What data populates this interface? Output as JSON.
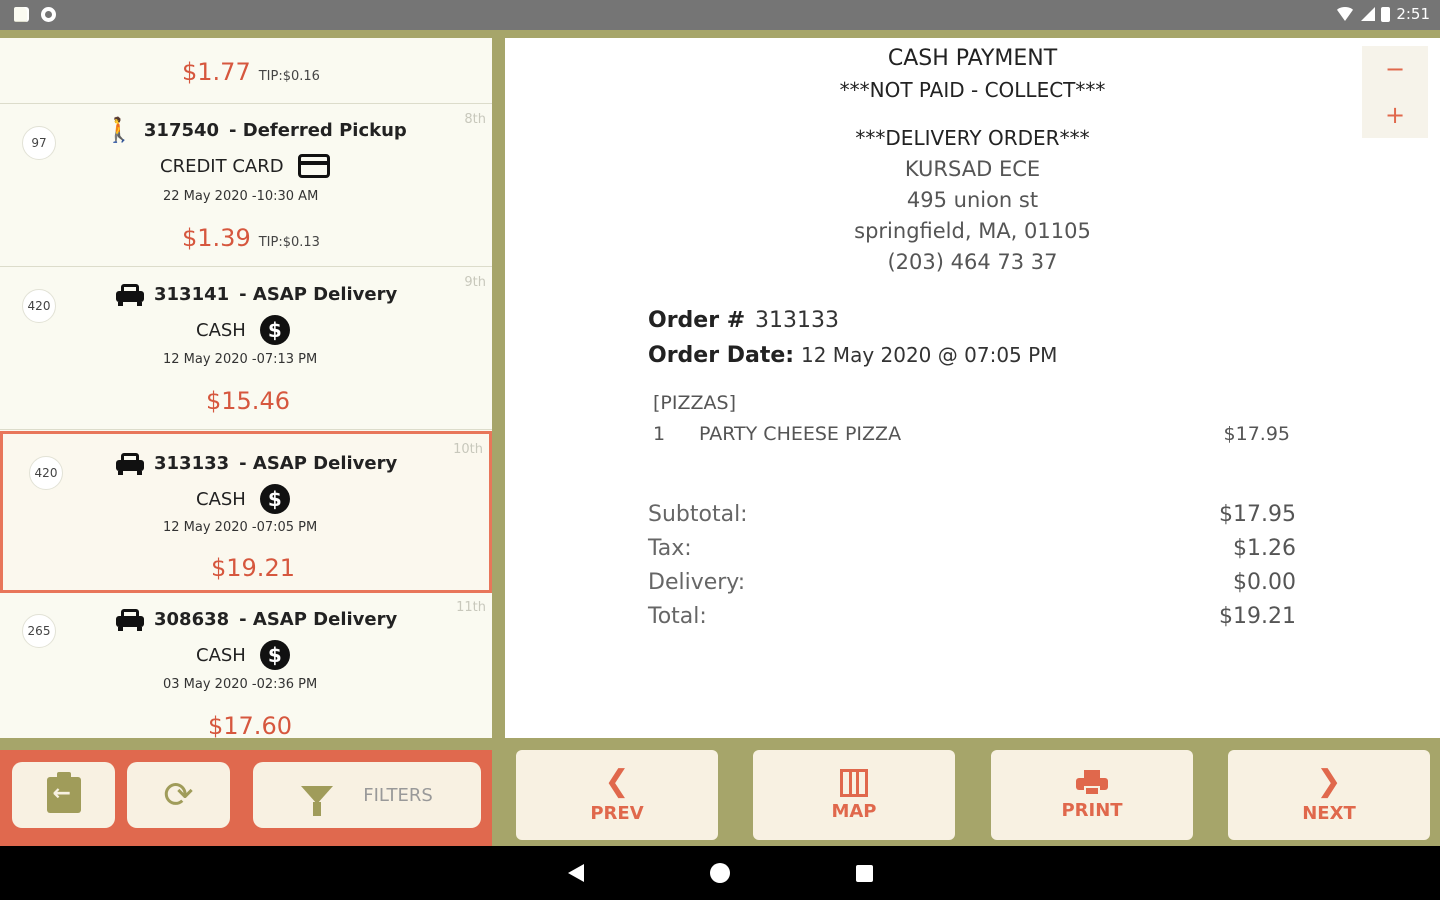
{
  "status_bar": {
    "time": "2:51"
  },
  "orders": [
    {
      "seq": "",
      "position": "",
      "title_number": "",
      "title_type": "",
      "payment": "",
      "date": "",
      "amount": "$1.77",
      "tip": "TIP:$0.16",
      "type": "partial"
    },
    {
      "seq": "97",
      "position": "8th",
      "title_number": "317540",
      "title_type": "- Deferred Pickup",
      "payment": "CREDIT CARD",
      "date": "22 May 2020 -10:30 AM",
      "amount": "$1.39",
      "tip": "TIP:$0.13",
      "type": "pickup",
      "payment_icon": "credit-card-icon"
    },
    {
      "seq": "420",
      "position": "9th",
      "title_number": "313141",
      "title_type": "- ASAP Delivery",
      "payment": "CASH",
      "date": "12 May 2020 -07:13 PM",
      "amount": "$15.46",
      "tip": "",
      "type": "delivery",
      "payment_icon": "dollar-icon"
    },
    {
      "seq": "420",
      "position": "10th",
      "title_number": "313133",
      "title_type": "- ASAP Delivery",
      "payment": "CASH",
      "date": "12 May 2020 -07:05 PM",
      "amount": "$19.21",
      "tip": "",
      "type": "delivery",
      "payment_icon": "dollar-icon",
      "selected": true
    },
    {
      "seq": "265",
      "position": "11th",
      "title_number": "308638",
      "title_type": "- ASAP Delivery",
      "payment": "CASH",
      "date": "03 May 2020 -02:36 PM",
      "amount": "$17.60",
      "tip": "",
      "type": "delivery",
      "payment_icon": "dollar-icon"
    }
  ],
  "receipt": {
    "payment_line": "CASH PAYMENT",
    "collect_line": "***NOT PAID - COLLECT***",
    "order_kind": "***DELIVERY ORDER***",
    "customer_name": "KURSAD ECE",
    "address1": "495 union st",
    "address2": "springfield, MA, 01105",
    "phone": "(203) 464 73 37",
    "order_no_label": "Order #",
    "order_no": "313133",
    "order_date_label": "Order Date:",
    "order_date": "12 May 2020 @ 07:05 PM",
    "category": "[PIZZAS]",
    "items": [
      {
        "qty": "1",
        "name": "PARTY CHEESE PIZZA",
        "price": "$17.95"
      }
    ],
    "totals": [
      {
        "label": "Subtotal:",
        "value": "$17.95"
      },
      {
        "label": "Tax:",
        "value": "$1.26"
      },
      {
        "label": "Delivery:",
        "value": "$0.00"
      },
      {
        "label": "Total:",
        "value": "$19.21"
      }
    ],
    "zoom_out": "−",
    "zoom_in": "+"
  },
  "bottom_left": {
    "filters_label": "FILTERS"
  },
  "nav": {
    "prev": "PREV",
    "map": "MAP",
    "print": "PRINT",
    "next": "NEXT"
  },
  "colors": {
    "accent": "#e0694e",
    "olive": "#a6a56a",
    "amount": "#d6573e"
  }
}
